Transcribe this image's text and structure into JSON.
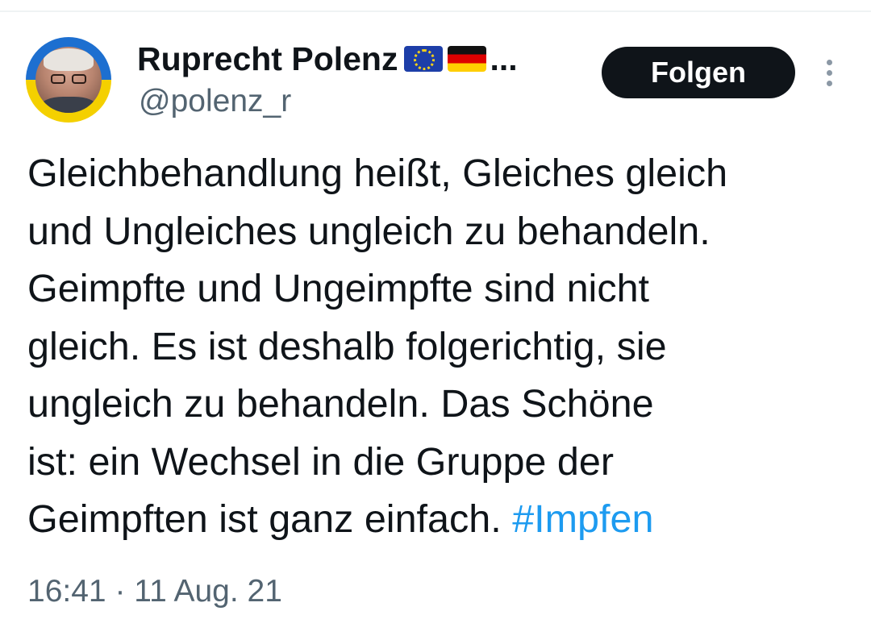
{
  "author": {
    "display_name": "Ruprecht Polenz",
    "name_overflow": "...",
    "flags": [
      "eu-flag-icon",
      "germany-flag-icon"
    ],
    "handle": "@polenz_r"
  },
  "actions": {
    "follow_label": "Folgen",
    "more_icon": "more-vertical-icon"
  },
  "tweet": {
    "lines": [
      "Gleichbehandlung heißt, Gleiches gleich",
      "und Ungleiches ungleich zu behandeln.",
      "Geimpfte und Ungeimpfte sind nicht",
      "gleich. Es ist deshalb folgerichtig, sie",
      "ungleich zu behandeln. Das Schöne",
      "ist: ein Wechsel in die Gruppe der"
    ],
    "last_line_text": "Geimpften ist ganz einfach. ",
    "hashtag": "#Impfen"
  },
  "meta": {
    "time": "16:41",
    "separator": "·",
    "date": "11 Aug. 21"
  },
  "colors": {
    "text": "#0f1419",
    "secondary": "#536471",
    "link": "#1d9bf0",
    "button_bg": "#0f1419"
  }
}
